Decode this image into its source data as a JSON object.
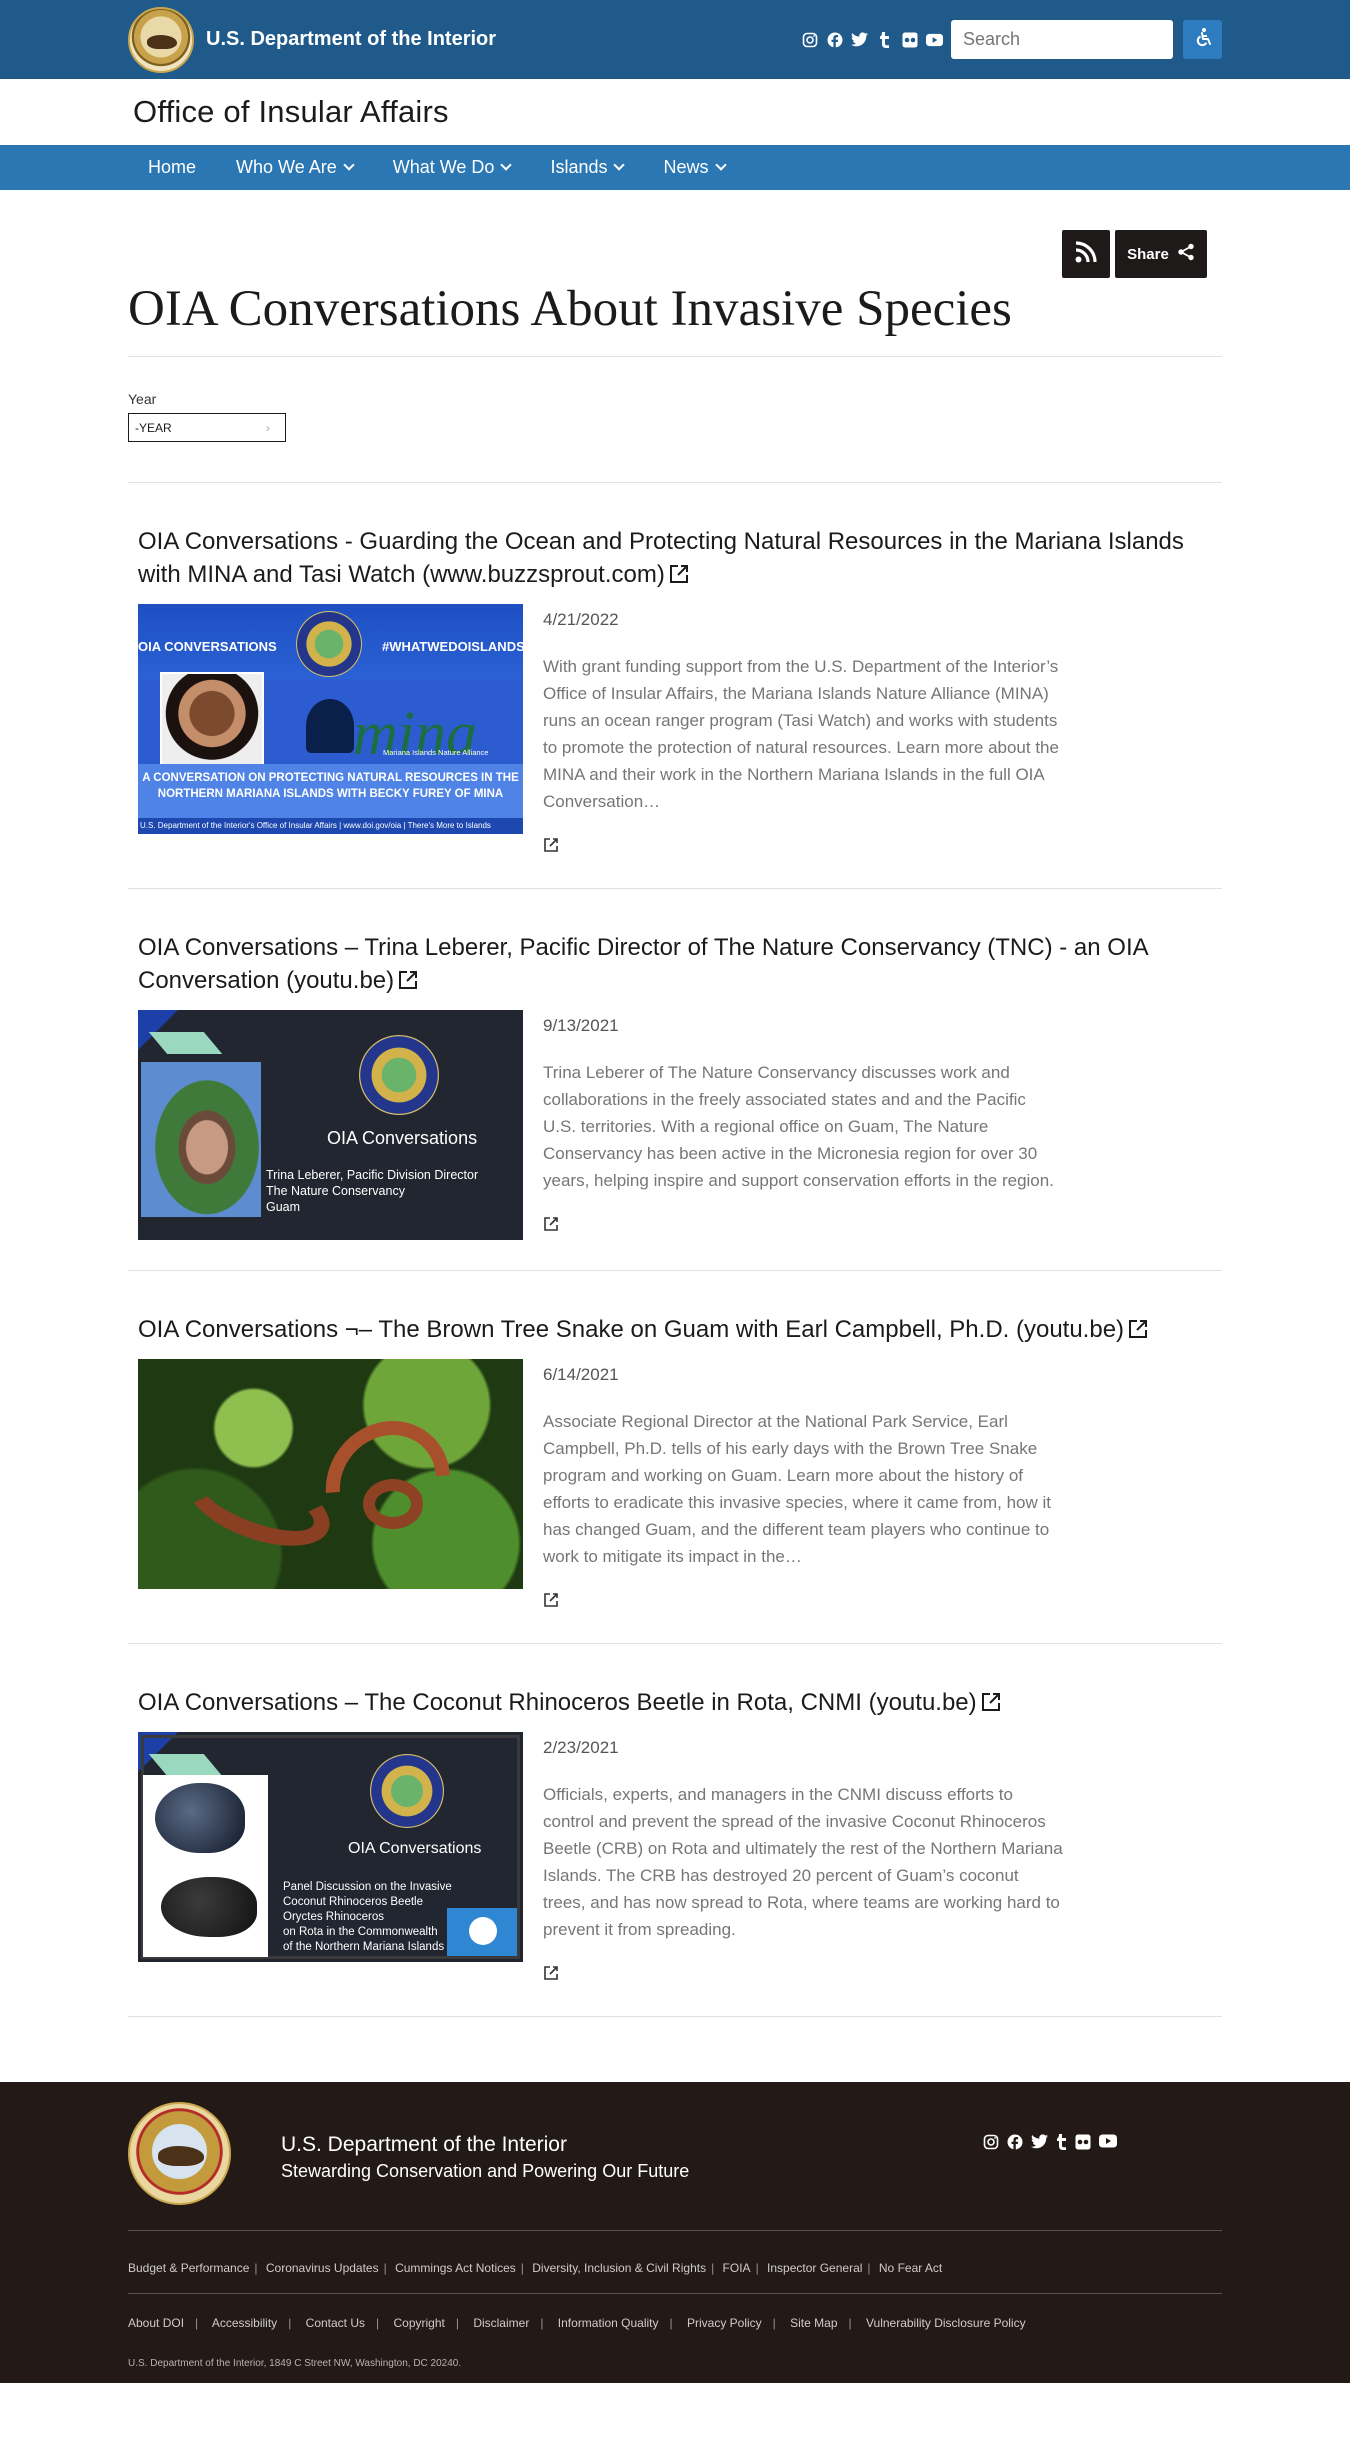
{
  "header": {
    "agency": "U.S. Department of the Interior",
    "search_placeholder": "Search",
    "social_icons": [
      "instagram-icon",
      "facebook-icon",
      "twitter-icon",
      "tumblr-icon",
      "flickr-icon",
      "youtube-icon"
    ]
  },
  "office": {
    "title": "Office of Insular Affairs"
  },
  "nav": {
    "items": [
      {
        "label": "Home"
      },
      {
        "label": "Who We Are"
      },
      {
        "label": "What We Do"
      },
      {
        "label": "Islands"
      },
      {
        "label": "News"
      }
    ]
  },
  "page": {
    "share_label": "Share",
    "title": "OIA Conversations About Invasive Species",
    "filter_label": "Year",
    "filter_value": "-YEAR"
  },
  "articles": [
    {
      "title": "OIA Conversations - Guarding the Ocean and Protecting Natural Resources in the Mariana Islands with MINA and Tasi Watch (www.buzzsprout.com)",
      "date": "4/21/2022",
      "description": "With grant funding support from the U.S. Department of the Interior’s Office of Insular Affairs, the Mariana Islands Nature Alliance (MINA) runs an ocean ranger program (Tasi Watch) and works with students to promote the protection of natural resources. Learn more about the MINA and their work in the Northern Mariana Islands in the full OIA Conversation…",
      "thumb": {
        "left_label": "OIA CONVERSATIONS",
        "right_label": "#WHATWEDOISLANDS",
        "logo_text": "mina",
        "logo_sub": "Mariana Islands Nature Alliance",
        "band": "A CONVERSATION ON PROTECTING NATURAL RESOURCES IN THE NORTHERN MARIANA ISLANDS WITH BECKY FUREY OF MINA",
        "footer": "U.S. Department of the Interior's Office of Insular Affairs | www.doi.gov/oia | There's More to Islands"
      }
    },
    {
      "title": "OIA Conversations – Trina Leberer, Pacific Director of The Nature Conservancy (TNC) - an OIA Conversation (youtu.be)",
      "date": "9/13/2021",
      "description": "Trina Leberer of The Nature Conservancy discusses work and collaborations in the freely associated states and and the Pacific U.S. territories. With a regional office on Guam, The Nature Conservancy has been active in the Micronesia region for over 30 years, helping inspire and support conservation efforts in the region.",
      "thumb": {
        "heading": "OIA Conversations",
        "line1": "Trina Leberer, Pacific Division Director",
        "line2": "The Nature Conservancy",
        "line3": "Guam"
      }
    },
    {
      "title": "OIA Conversations ¬– The Brown Tree Snake on Guam with Earl Campbell, Ph.D. (youtu.be)",
      "date": "6/14/2021",
      "description": "Associate Regional Director at the National Park Service, Earl Campbell, Ph.D. tells of his early days with the Brown Tree Snake program and working on Guam. Learn more about the history of efforts to eradicate this invasive species, where it came from, how it has changed Guam, and the different team players who continue to work to mitigate its impact in the…"
    },
    {
      "title": "OIA Conversations – The Coconut Rhinoceros Beetle in Rota, CNMI (youtu.be)",
      "date": "2/23/2021",
      "description": "Officials, experts, and managers in the CNMI discuss efforts to control and prevent the spread of the invasive Coconut Rhinoceros Beetle (CRB) on Rota and ultimately the rest of the Northern Mariana Islands. The CRB has destroyed 20 percent of Guam’s coconut trees, and has now spread to Rota, where teams are working hard to prevent it from spreading.",
      "thumb": {
        "heading": "OIA Conversations",
        "line1": "Panel Discussion on the Invasive",
        "line2": "Coconut Rhinoceros Beetle",
        "line3": "Oryctes Rhinoceros",
        "line4": "on Rota in the Commonwealth",
        "line5": "of the Northern Mariana Islands"
      }
    }
  ],
  "footer": {
    "title": "U.S. Department of the Interior",
    "subtitle": "Stewarding Conservation and Powering Our Future",
    "links_row1": [
      "Budget & Performance",
      "Coronavirus Updates",
      "Cummings Act Notices",
      "Diversity, Inclusion & Civil Rights",
      "FOIA",
      "Inspector General",
      "No Fear Act"
    ],
    "links_row2": [
      "About DOI",
      "Accessibility",
      "Contact Us",
      "Copyright",
      "Disclaimer",
      "Information Quality",
      "Privacy Policy",
      "Site Map",
      "Vulnerability Disclosure Policy"
    ],
    "address": "U.S. Department of the Interior, 1849 C Street NW, Washington, DC 20240."
  },
  "colors": {
    "topbar": "#1f5a8a",
    "nav": "#2b77b4",
    "footer": "#231a18",
    "accessibility_button": "#2d7cc0"
  }
}
